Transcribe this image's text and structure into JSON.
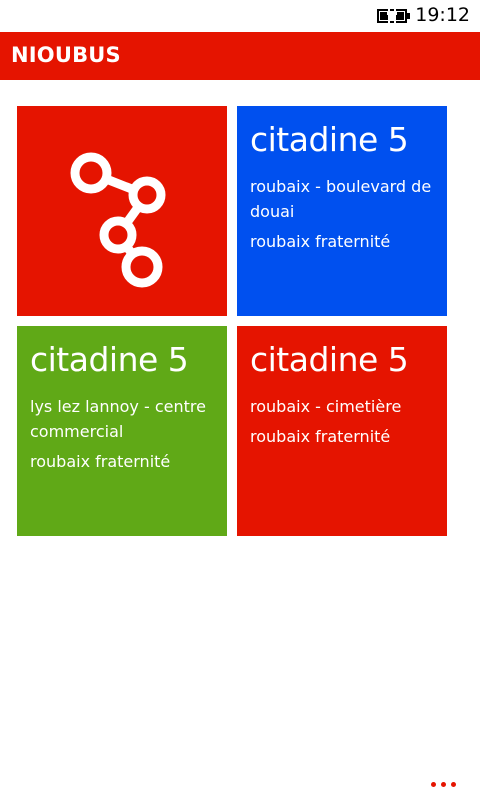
{
  "status_bar": {
    "time": "19:12",
    "battery_icon": "battery-charging-icon"
  },
  "header": {
    "title": "NIOUBUS",
    "color": "#e51400"
  },
  "share_tile": {
    "icon": "share-icon",
    "color": "#e51400"
  },
  "tiles": [
    {
      "line": "citadine 5",
      "from": "roubaix - boulevard de douai",
      "to": "roubaix fraternité",
      "color": "#0050ef"
    },
    {
      "line": "citadine 5",
      "from": "lys lez lannoy - centre commercial",
      "to": "roubaix fraternité",
      "color": "#60a917"
    },
    {
      "line": "citadine 5",
      "from": "roubaix - cimetière",
      "to": "roubaix fraternité",
      "color": "#e51400"
    }
  ],
  "app_bar": {
    "more_icon": "ellipsis-icon",
    "dot_color": "#e51400"
  }
}
